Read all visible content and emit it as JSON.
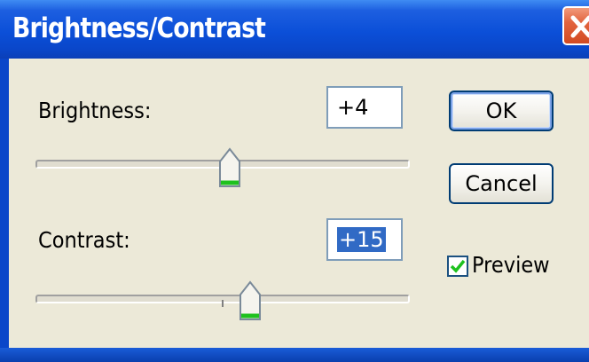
{
  "window": {
    "title": "Brightness/Contrast"
  },
  "brightness": {
    "label": "Brightness:",
    "value": "+4"
  },
  "contrast": {
    "label": "Contrast:",
    "value": "+15"
  },
  "buttons": {
    "ok": "OK",
    "cancel": "Cancel"
  },
  "preview": {
    "label": "Preview",
    "checked": true
  },
  "icons": {
    "close": "close-icon",
    "check": "checkmark-icon",
    "slider_thumb": "slider-thumb-icon"
  },
  "colors": {
    "titlebar": "#0a46c9",
    "dialog_bg": "#ece9d8",
    "close_button": "#d24a22",
    "selection": "#316ac5",
    "thumb_accent": "#1ec11e"
  }
}
